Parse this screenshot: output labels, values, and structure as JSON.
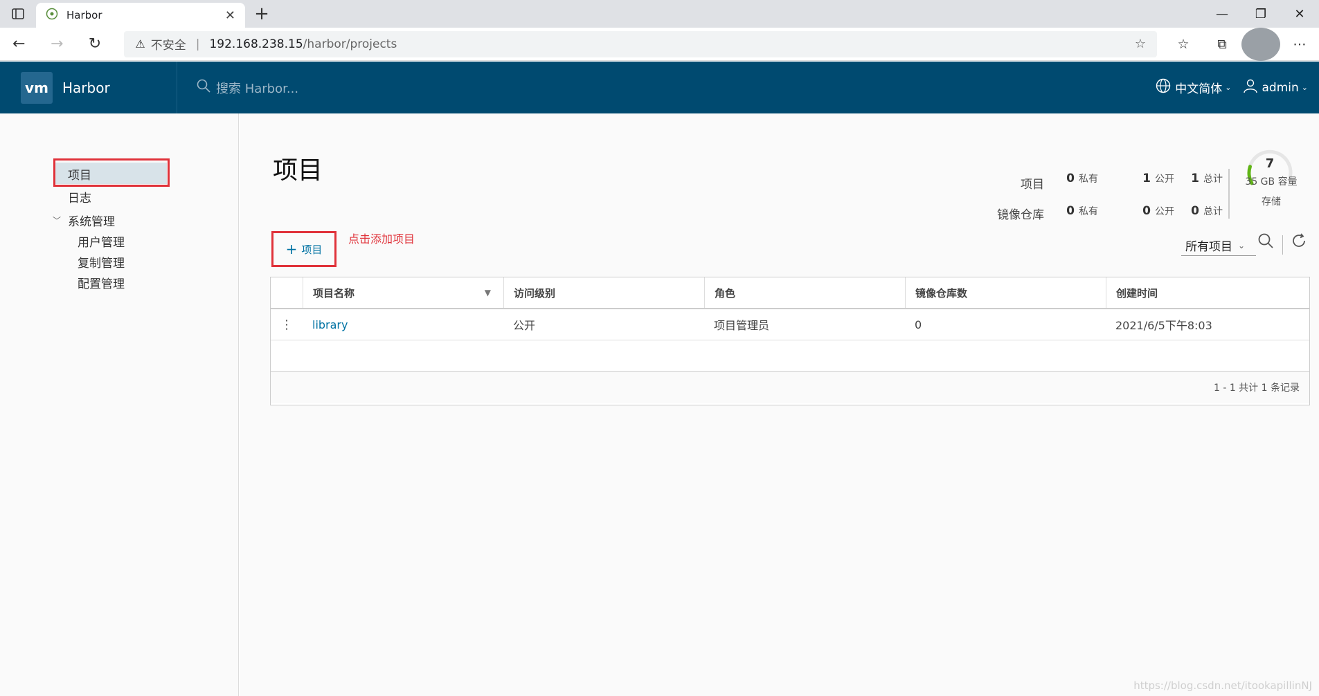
{
  "browser": {
    "tab_title": "Harbor",
    "security_label": "不安全",
    "url_host": "192.168.238.15",
    "url_path": "/harbor/projects"
  },
  "header": {
    "brand": "Harbor",
    "logo_text": "vm",
    "search_placeholder": "搜索 Harbor...",
    "language": "中文简体",
    "user": "admin"
  },
  "sidebar": {
    "projects": "项目",
    "logs": "日志",
    "admin": "系统管理",
    "user_mgmt": "用户管理",
    "replication": "复制管理",
    "config": "配置管理"
  },
  "page": {
    "title": "项目",
    "add_button": "项目",
    "add_hint": "点击添加项目"
  },
  "stats": {
    "projects_label": "项目",
    "repos_label": "镜像仓库",
    "projects_private": "0",
    "projects_public": "1",
    "projects_total": "1",
    "repos_private": "0",
    "repos_public": "0",
    "repos_total": "0",
    "private_label": "私有",
    "public_label": "公开",
    "total_label": "总计",
    "storage_value": "7",
    "storage_capacity": "35 GB 容量",
    "storage_label": "存储",
    "storage_fraction": 0.2
  },
  "toolbar": {
    "filter_value": "所有项目"
  },
  "table": {
    "headers": [
      "项目名称",
      "访问级别",
      "角色",
      "镜像仓库数",
      "创建时间"
    ],
    "rows": [
      {
        "name": "library",
        "access": "公开",
        "role": "项目管理员",
        "repos": "0",
        "created": "2021/6/5下午8:03"
      }
    ],
    "footer": "1 - 1 共计 1 条记录"
  },
  "watermark": "https://blog.csdn.net/itookapillinNJ",
  "colors": {
    "header_bg": "#004a70",
    "accent": "#0072a3",
    "highlight": "#e0323a",
    "gauge": "#60b515"
  }
}
